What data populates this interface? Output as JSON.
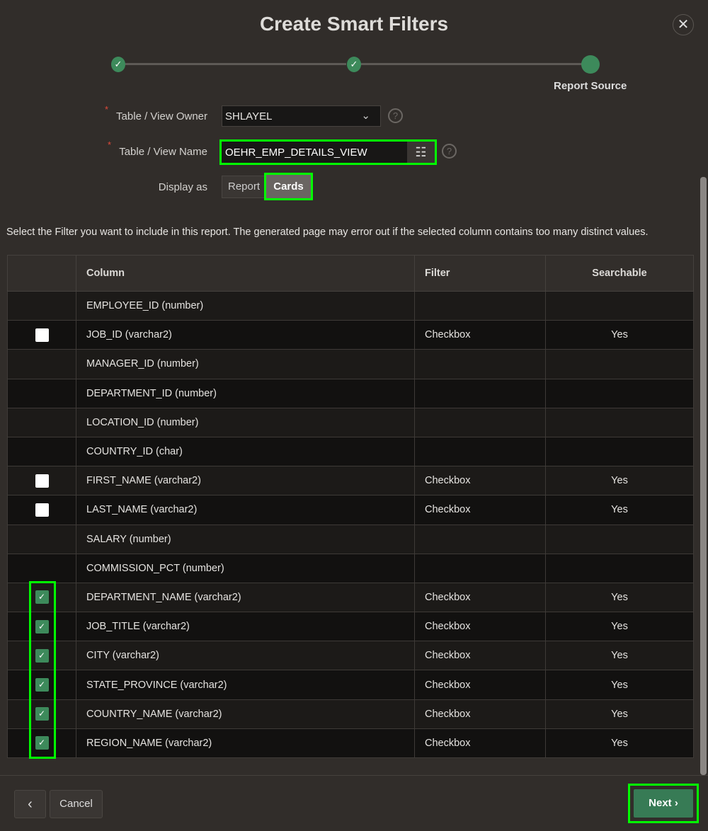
{
  "dialog": {
    "title": "Create Smart Filters",
    "close_icon": "close-icon"
  },
  "wizard": {
    "steps": [
      {
        "status": "complete"
      },
      {
        "status": "complete"
      },
      {
        "status": "current",
        "label": "Report Source"
      }
    ]
  },
  "form": {
    "owner": {
      "label": "Table / View Owner",
      "value": "SHLAYEL"
    },
    "name": {
      "label": "Table / View Name",
      "value": "OEHR_EMP_DETAILS_VIEW"
    },
    "display_as": {
      "label": "Display as",
      "options": [
        "Report",
        "Cards"
      ],
      "selected": "Cards"
    },
    "required_mark": "*",
    "help": "?"
  },
  "description": "Select the Filter you want to include in this report. The generated page may error out if the selected column contains too many distinct values.",
  "table": {
    "headers": [
      "",
      "Column",
      "Filter",
      "Searchable"
    ],
    "rows": [
      {
        "checkbox": null,
        "column": "EMPLOYEE_ID (number)",
        "filter": "",
        "searchable": ""
      },
      {
        "checkbox": false,
        "column": "JOB_ID (varchar2)",
        "filter": "Checkbox",
        "searchable": "Yes"
      },
      {
        "checkbox": null,
        "column": "MANAGER_ID (number)",
        "filter": "",
        "searchable": ""
      },
      {
        "checkbox": null,
        "column": "DEPARTMENT_ID (number)",
        "filter": "",
        "searchable": ""
      },
      {
        "checkbox": null,
        "column": "LOCATION_ID (number)",
        "filter": "",
        "searchable": ""
      },
      {
        "checkbox": null,
        "column": "COUNTRY_ID (char)",
        "filter": "",
        "searchable": ""
      },
      {
        "checkbox": false,
        "column": "FIRST_NAME (varchar2)",
        "filter": "Checkbox",
        "searchable": "Yes"
      },
      {
        "checkbox": false,
        "column": "LAST_NAME (varchar2)",
        "filter": "Checkbox",
        "searchable": "Yes"
      },
      {
        "checkbox": null,
        "column": "SALARY (number)",
        "filter": "",
        "searchable": ""
      },
      {
        "checkbox": null,
        "column": "COMMISSION_PCT (number)",
        "filter": "",
        "searchable": ""
      },
      {
        "checkbox": true,
        "column": "DEPARTMENT_NAME (varchar2)",
        "filter": "Checkbox",
        "searchable": "Yes"
      },
      {
        "checkbox": true,
        "column": "JOB_TITLE (varchar2)",
        "filter": "Checkbox",
        "searchable": "Yes"
      },
      {
        "checkbox": true,
        "column": "CITY (varchar2)",
        "filter": "Checkbox",
        "searchable": "Yes"
      },
      {
        "checkbox": true,
        "column": "STATE_PROVINCE (varchar2)",
        "filter": "Checkbox",
        "searchable": "Yes"
      },
      {
        "checkbox": true,
        "column": "COUNTRY_NAME (varchar2)",
        "filter": "Checkbox",
        "searchable": "Yes"
      },
      {
        "checkbox": true,
        "column": "REGION_NAME (varchar2)",
        "filter": "Checkbox",
        "searchable": "Yes"
      }
    ]
  },
  "footer": {
    "back": "‹",
    "cancel": "Cancel",
    "next": "Next"
  },
  "colors": {
    "accent": "#3d8a5b",
    "highlight": "#00ff00",
    "background": "#312d2a"
  }
}
